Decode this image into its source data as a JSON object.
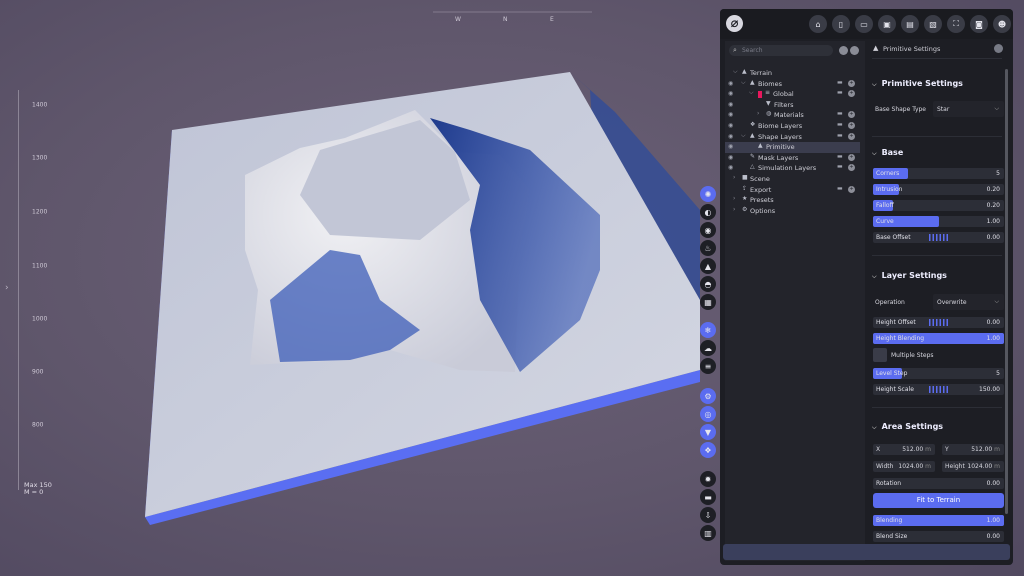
{
  "viewport": {
    "compass": {
      "letters": [
        "W",
        "N",
        "E"
      ]
    },
    "ruler": {
      "labels": [
        "1400",
        "1300",
        "1200",
        "1100",
        "1000",
        "900",
        "800"
      ]
    },
    "height_readout": {
      "max": "Max 150",
      "min": "M = 0"
    },
    "left_arrow": "›",
    "tools_top": [
      {
        "name": "sun-icon",
        "glyph": "✺",
        "active": true
      },
      {
        "name": "contrast-icon",
        "glyph": "◐",
        "active": false
      },
      {
        "name": "sphere-icon",
        "glyph": "◉",
        "active": false
      },
      {
        "name": "flame-icon",
        "glyph": "♨",
        "active": false
      },
      {
        "name": "mountain-icon",
        "glyph": "▲",
        "active": false
      },
      {
        "name": "horizon-icon",
        "glyph": "◓",
        "active": false
      },
      {
        "name": "grid-icon",
        "glyph": "▦",
        "active": false
      }
    ],
    "tools_mid": [
      {
        "name": "snow-icon",
        "glyph": "❄",
        "active": true
      },
      {
        "name": "cloud-icon",
        "glyph": "☁",
        "active": false
      },
      {
        "name": "lines-icon",
        "glyph": "≡",
        "active": false
      }
    ],
    "tools_lower": [
      {
        "name": "gears-icon",
        "glyph": "⚙",
        "active": true
      },
      {
        "name": "eye-icon",
        "glyph": "◎",
        "active": true
      },
      {
        "name": "filter-icon",
        "glyph": "▼",
        "active": true
      },
      {
        "name": "layers-icon",
        "glyph": "❖",
        "active": true
      }
    ],
    "tools_bottom": [
      {
        "name": "settings-icon",
        "glyph": "✹",
        "active": false
      },
      {
        "name": "folder-icon",
        "glyph": "▬",
        "active": false
      },
      {
        "name": "download-icon",
        "glyph": "⇩",
        "active": false
      },
      {
        "name": "chart-icon",
        "glyph": "▥",
        "active": false
      }
    ]
  },
  "toolbar": {
    "logo": "⌀",
    "buttons": [
      {
        "name": "home-icon",
        "glyph": "⌂"
      },
      {
        "name": "new-file-icon",
        "glyph": "▯"
      },
      {
        "name": "open-folder-icon",
        "glyph": "▭"
      },
      {
        "name": "save-icon",
        "glyph": "▣"
      },
      {
        "name": "save-all-icon",
        "glyph": "▤"
      },
      {
        "name": "save-as-icon",
        "glyph": "▧"
      },
      {
        "name": "fullscreen-icon",
        "glyph": "⛶"
      },
      {
        "name": "screenshot-icon",
        "glyph": "◙"
      },
      {
        "name": "users-icon",
        "glyph": "☻"
      }
    ]
  },
  "tree": {
    "search_placeholder": "Search",
    "items": [
      {
        "label": "Terrain",
        "indent": 0,
        "eye": false,
        "chev": "⌵",
        "icon": "▲",
        "actions": false,
        "selected": false
      },
      {
        "label": "Biomes",
        "indent": 1,
        "eye": true,
        "chev": "⌵",
        "icon": "▲",
        "actions": true,
        "selected": false
      },
      {
        "label": "Global",
        "indent": 2,
        "eye": true,
        "chev": "⌵",
        "icon": "≡",
        "actions": true,
        "selected": false,
        "color": "#e8175d"
      },
      {
        "label": "Filters",
        "indent": 3,
        "eye": true,
        "chev": "",
        "icon": "▼",
        "actions": false,
        "selected": false
      },
      {
        "label": "Materials",
        "indent": 3,
        "eye": true,
        "chev": "›",
        "icon": "◍",
        "actions": true,
        "selected": false
      },
      {
        "label": "Biome Layers",
        "indent": 1,
        "eye": true,
        "chev": "",
        "icon": "❖",
        "actions": true,
        "selected": false
      },
      {
        "label": "Shape Layers",
        "indent": 1,
        "eye": true,
        "chev": "⌵",
        "icon": "▲",
        "actions": true,
        "selected": false
      },
      {
        "label": "Primitive",
        "indent": 2,
        "eye": true,
        "chev": "",
        "icon": "▲",
        "actions": false,
        "selected": true
      },
      {
        "label": "Mask Layers",
        "indent": 1,
        "eye": true,
        "chev": "",
        "icon": "✎",
        "actions": true,
        "selected": false
      },
      {
        "label": "Simulation Layers",
        "indent": 1,
        "eye": true,
        "chev": "",
        "icon": "△",
        "actions": true,
        "selected": false
      },
      {
        "label": "Scene",
        "indent": 0,
        "eye": false,
        "chev": "›",
        "icon": "■",
        "actions": false,
        "selected": false
      },
      {
        "label": "Export",
        "indent": 0,
        "eye": false,
        "chev": "",
        "icon": "⇪",
        "actions": true,
        "selected": false
      },
      {
        "label": "Presets",
        "indent": 0,
        "eye": false,
        "chev": "›",
        "icon": "★",
        "actions": false,
        "selected": false
      },
      {
        "label": "Options",
        "indent": 0,
        "eye": false,
        "chev": "›",
        "icon": "⚙",
        "actions": false,
        "selected": false
      }
    ]
  },
  "props": {
    "header": "Primitive Settings",
    "primitive_title": "Primitive Settings",
    "base_shape_label": "Base Shape Type",
    "base_shape_value": "Star",
    "base_title": "Base",
    "corners": {
      "label": "Corners",
      "value": "5",
      "fill": 0.27
    },
    "intrusion": {
      "label": "Intrusion",
      "value": "0.20",
      "fill": 0.2
    },
    "falloff": {
      "label": "Falloff",
      "value": "0.20",
      "fill": 0.15
    },
    "curve": {
      "label": "Curve",
      "value": "1.00",
      "fill": 0.5
    },
    "base_offset": {
      "label": "Base Offset",
      "value": "0.00"
    },
    "layer_title": "Layer Settings",
    "operation_label": "Operation",
    "operation_value": "Overwrite",
    "height_offset": {
      "label": "Height Offset",
      "value": "0.00"
    },
    "height_blending": {
      "label": "Height Blending",
      "value": "1.00",
      "fill": 1.0
    },
    "multiple_steps": "Multiple Steps",
    "level_step": {
      "label": "Level Step",
      "value": "5",
      "fill": 0.22
    },
    "height_scale": {
      "label": "Height Scale",
      "value": "150.00"
    },
    "area_title": "Area Settings",
    "x": {
      "label": "X",
      "value": "512.00",
      "unit": "m"
    },
    "y": {
      "label": "Y",
      "value": "512.00",
      "unit": "m"
    },
    "width": {
      "label": "Width",
      "value": "1024.00",
      "unit": "m"
    },
    "height": {
      "label": "Height",
      "value": "1024.00",
      "unit": "m"
    },
    "rotation": {
      "label": "Rotation",
      "value": "0.00"
    },
    "fit_button": "Fit to Terrain",
    "blending": {
      "label": "Blending",
      "value": "1.00",
      "fill": 1.0
    },
    "blend_size": {
      "label": "Blend Size",
      "value": "0.00"
    }
  },
  "colors": {
    "accent": "#5b6cf0",
    "panel_bg": "#1d1e24",
    "tree_bg": "#23242b",
    "biome_tag": "#e8175d"
  }
}
